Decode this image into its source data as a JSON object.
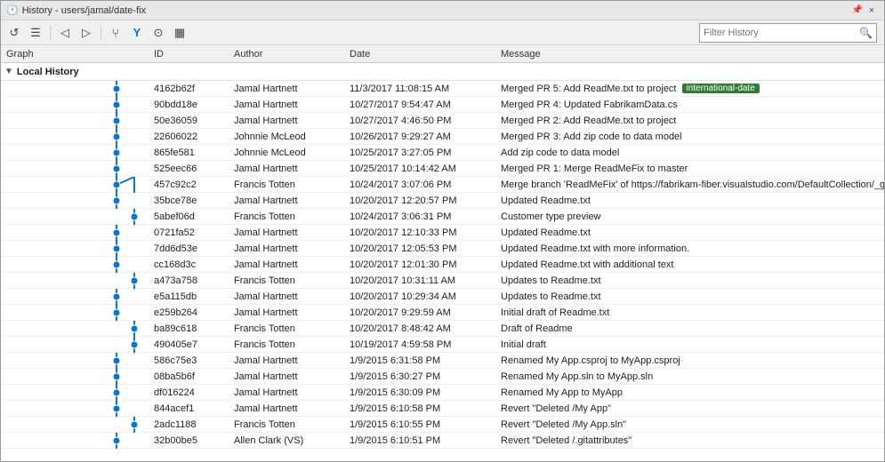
{
  "titleBar": {
    "title": "History - users/jamal/date-fix",
    "pinIcon": "📌",
    "closeLabel": "×"
  },
  "toolbar": {
    "buttons": [
      {
        "name": "refresh",
        "icon": "↺"
      },
      {
        "name": "list-view",
        "icon": "☰"
      },
      {
        "name": "back",
        "icon": "◁"
      },
      {
        "name": "forward",
        "icon": "▷"
      },
      {
        "name": "push-commits",
        "icon": "↑"
      },
      {
        "name": "filter-branch",
        "icon": "⑂"
      },
      {
        "name": "remote-toggle",
        "icon": "⊙"
      },
      {
        "name": "graph-toggle",
        "icon": "⬛"
      }
    ],
    "filterPlaceholder": "Filter History",
    "filterLabel": "Filter History"
  },
  "columns": {
    "graph": "Graph",
    "id": "ID",
    "author": "Author",
    "date": "Date",
    "message": "Message"
  },
  "sectionHeader": "Local History",
  "rows": [
    {
      "id": "4162b62f",
      "author": "Jamal Hartnett",
      "date": "11/3/2017 11:08:15 AM",
      "message": "Merged PR 5: Add ReadMe.txt to project",
      "tag": "international-date"
    },
    {
      "id": "90bdd18e",
      "author": "Jamal Hartnett",
      "date": "10/27/2017 9:54:47 AM",
      "message": "Merged PR 4: Updated FabrikamData.cs",
      "tag": ""
    },
    {
      "id": "50e36059",
      "author": "Jamal Hartnett",
      "date": "10/27/2017 4:46:50 PM",
      "message": "Merged PR 2: Add ReadMe.txt to project",
      "tag": ""
    },
    {
      "id": "22606022",
      "author": "Johnnie McLeod",
      "date": "10/26/2017 9:29:27 AM",
      "message": "Merged PR 3: Add zip code to data model",
      "tag": ""
    },
    {
      "id": "865fe581",
      "author": "Johnnie McLeod",
      "date": "10/25/2017 3:27:05 PM",
      "message": "Add zip code to data model",
      "tag": ""
    },
    {
      "id": "525eec66",
      "author": "Jamal Hartnett",
      "date": "10/25/2017 10:14:42 AM",
      "message": "Merged PR 1: Merge ReadMeFix to master",
      "tag": ""
    },
    {
      "id": "457c92c2",
      "author": "Francis Totten",
      "date": "10/24/2017 3:07:06 PM",
      "message": "Merge branch 'ReadMeFix' of https://fabrikam-fiber.visualstudio.com/DefaultCollection/_git/...",
      "tag": ""
    },
    {
      "id": "35bce78e",
      "author": "Jamal Hartnett",
      "date": "10/20/2017 12:20:57 PM",
      "message": "Updated Readme.txt",
      "tag": ""
    },
    {
      "id": "5abef06d",
      "author": "Francis Totten",
      "date": "10/24/2017 3:06:31 PM",
      "message": "Customer type preview",
      "tag": ""
    },
    {
      "id": "0721fa52",
      "author": "Jamal Hartnett",
      "date": "10/20/2017 12:10:33 PM",
      "message": "Updated Readme.txt",
      "tag": ""
    },
    {
      "id": "7dd6d53e",
      "author": "Jamal Hartnett",
      "date": "10/20/2017 12:05:53 PM",
      "message": "Updated Readme.txt with more information.",
      "tag": ""
    },
    {
      "id": "cc168d3c",
      "author": "Jamal Hartnett",
      "date": "10/20/2017 12:01:30 PM",
      "message": "Updated Readme.txt with additional text",
      "tag": ""
    },
    {
      "id": "a473a758",
      "author": "Francis Totten",
      "date": "10/20/2017 10:31:11 AM",
      "message": "Updates to Readme.txt",
      "tag": ""
    },
    {
      "id": "e5a115db",
      "author": "Jamal Hartnett",
      "date": "10/20/2017 10:29:34 AM",
      "message": "Updates to Readme.txt",
      "tag": ""
    },
    {
      "id": "e259b264",
      "author": "Jamal Hartnett",
      "date": "10/20/2017 9:29:59 AM",
      "message": "Initial draft of Readme.txt",
      "tag": ""
    },
    {
      "id": "ba89c618",
      "author": "Francis Totten",
      "date": "10/20/2017 8:48:42 AM",
      "message": "Draft of Readme",
      "tag": ""
    },
    {
      "id": "490405e7",
      "author": "Francis Totten",
      "date": "10/19/2017 4:59:58 PM",
      "message": "Initial draft",
      "tag": ""
    },
    {
      "id": "586c75e3",
      "author": "Jamal Hartnett",
      "date": "1/9/2015 6:31:58 PM",
      "message": "Renamed My App.csproj to MyApp.csproj",
      "tag": ""
    },
    {
      "id": "08ba5b6f",
      "author": "Jamal Hartnett",
      "date": "1/9/2015 6:30:27 PM",
      "message": "Renamed My App.sln to MyApp.sln",
      "tag": ""
    },
    {
      "id": "df016224",
      "author": "Jamal Hartnett",
      "date": "1/9/2015 6:30:09 PM",
      "message": "Renamed My App to MyApp",
      "tag": ""
    },
    {
      "id": "844acef1",
      "author": "Jamal Hartnett",
      "date": "1/9/2015 6:10:58 PM",
      "message": "Revert \"Deleted /My App\"",
      "tag": ""
    },
    {
      "id": "2adc1188",
      "author": "Francis Totten",
      "date": "1/9/2015 6:10:55 PM",
      "message": "Revert \"Deleted /My App.sln\"",
      "tag": ""
    },
    {
      "id": "32b00be5",
      "author": "Allen Clark (VS)",
      "date": "1/9/2015 6:10:51 PM",
      "message": "Revert \"Deleted /.gitattributes\"",
      "tag": ""
    }
  ],
  "colors": {
    "graphLine": "#0078d7",
    "graphLineMerge": "#888888",
    "graphDot": "#0078d7",
    "graphDotMerge": "#888888",
    "tagBg": "#2e7d32",
    "tagText": "#ffffff",
    "accent": "#0078d7"
  }
}
